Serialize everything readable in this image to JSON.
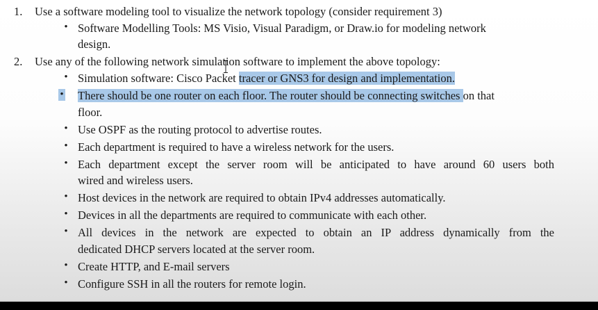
{
  "items": [
    {
      "num": "1.",
      "text": "Use a software modeling tool to visualize the network topology (consider requirement 3)"
    },
    {
      "num": "2.",
      "text": "Use any of the following network simulation software to implement the above topology:"
    }
  ],
  "sub1": [
    {
      "l1": "Software Modelling Tools: MS Visio, Visual Paradigm, or Draw.io for modeling network",
      "l2": "design."
    }
  ],
  "sub2": {
    "sim_a": "Simulation software: Cisco Packet ",
    "sim_b": "tracer or GNS3 for design and implementation.",
    "router_hl": "There should be one router on each floor. The router should be connecting switches ",
    "router_rest": "on that",
    "router_l2": "floor.",
    "ospf": "Use OSPF as the routing protocol to advertise routes.",
    "wireless": "Each department is required to have a wireless network for the users.",
    "users_l1": "Each department except the server room will be anticipated to have around 60 users both",
    "users_l2": "wired and wireless users.",
    "ipv4": "Host devices in the network are required to obtain IPv4 addresses automatically.",
    "comm": "Devices in all the departments are required to communicate with each other.",
    "dhcp_l1": "All devices in the network are expected to obtain an IP address dynamically from the",
    "dhcp_l2": "dedicated DHCP servers located at the server room.",
    "http": "Create HTTP, and E-mail servers",
    "ssh": "Configure SSH in all the routers for remote login."
  },
  "bullet_glyph": "•",
  "highlight_color": "#a8c8e8"
}
